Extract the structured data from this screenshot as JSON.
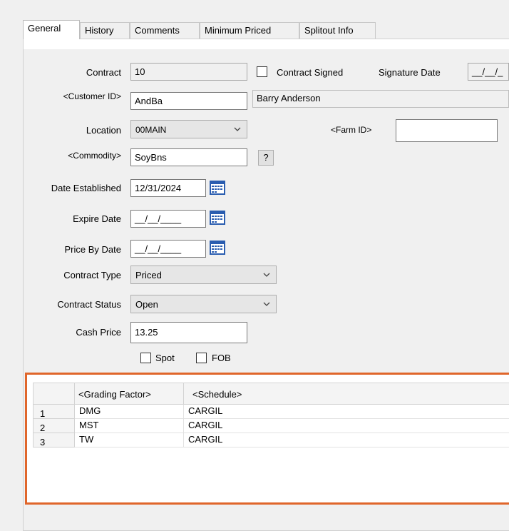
{
  "tabs": [
    {
      "label": "General",
      "active": true
    },
    {
      "label": "History"
    },
    {
      "label": "Comments"
    },
    {
      "label": "Minimum Priced"
    },
    {
      "label": "Splitout Info"
    }
  ],
  "form": {
    "contract_label": "Contract",
    "contract_value": "10",
    "contract_signed_label": "Contract Signed",
    "signature_date_label": "Signature Date",
    "signature_date_value": "__/__/_",
    "customer_id_label": "<Customer ID>",
    "customer_id_value": "AndBa",
    "customer_name": "Barry Anderson",
    "location_label": "Location",
    "location_value": "00MAIN",
    "farm_id_label": "<Farm ID>",
    "farm_id_value": "",
    "commodity_label": "<Commodity>",
    "commodity_value": "SoyBns",
    "commodity_lookup": "?",
    "date_established_label": "Date Established",
    "date_established_value": "12/31/2024",
    "expire_date_label": "Expire Date",
    "expire_date_value": "__/__/____",
    "price_by_date_label": "Price By Date",
    "price_by_date_value": "__/__/____",
    "contract_type_label": "Contract Type",
    "contract_type_value": "Priced",
    "contract_status_label": "Contract Status",
    "contract_status_value": "Open",
    "cash_price_label": "Cash Price",
    "cash_price_value": "13.25",
    "spot_label": "Spot",
    "fob_label": "FOB"
  },
  "grid": {
    "columns": [
      "<Grading Factor>",
      "<Schedule>"
    ],
    "rows": [
      {
        "num": "1",
        "factor": "DMG",
        "schedule": "CARGIL"
      },
      {
        "num": "2",
        "factor": "MST",
        "schedule": "CARGIL"
      },
      {
        "num": "3",
        "factor": "TW",
        "schedule": "CARGIL"
      }
    ]
  },
  "colors": {
    "highlight": "#e0662b",
    "calendar": "#2a5db0"
  }
}
